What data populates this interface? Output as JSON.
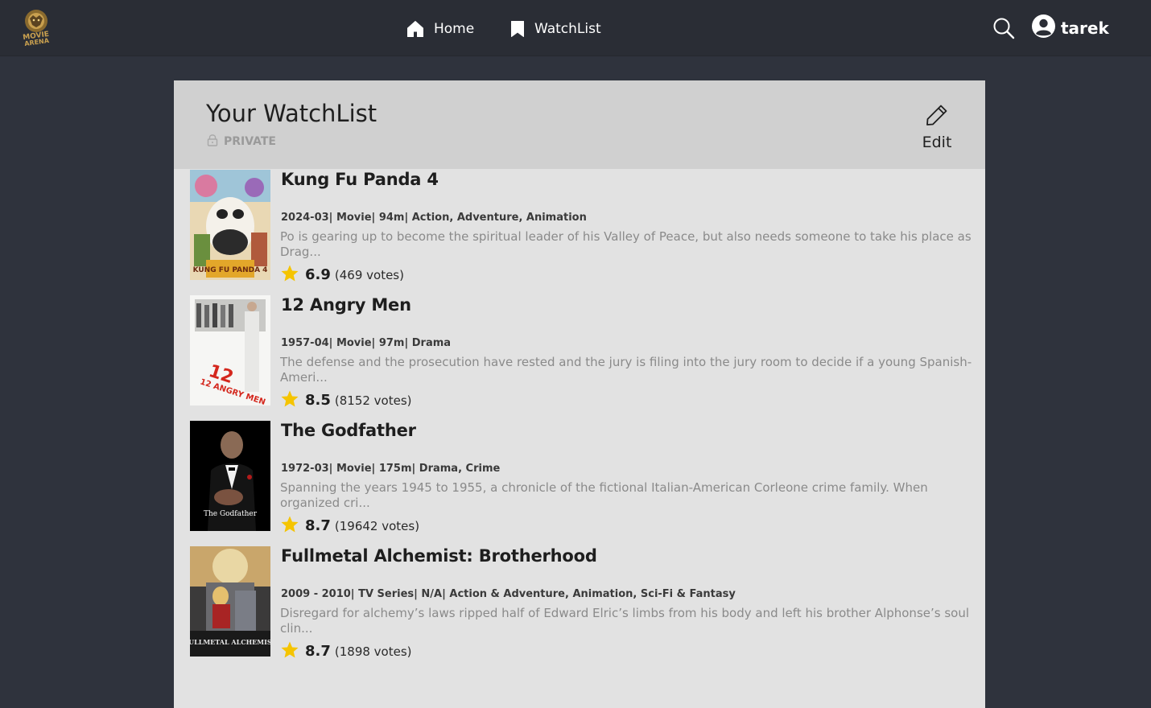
{
  "nav": {
    "logo_text": "MOVIE ARENA",
    "home_label": "Home",
    "watchlist_label": "WatchList",
    "user_name": "tarek"
  },
  "watchlist": {
    "title": "Your WatchList",
    "privacy": "PRIVATE",
    "edit_label": "Edit",
    "items": [
      {
        "title": "Kung Fu Panda 4",
        "meta": "2024-03| Movie| 94m| Action, Adventure, Animation",
        "description": "Po is gearing up to become the spiritual leader of his Valley of Peace, but also needs someone to take his place as Drag...",
        "rating": "6.9",
        "votes": "(469 votes)",
        "poster_text": "KUNG FU PANDA 4"
      },
      {
        "title": "12 Angry Men",
        "meta": "1957-04| Movie| 97m| Drama",
        "description": "The defense and the prosecution have rested and the jury is filing into the jury room to decide if a young Spanish-Ameri...",
        "rating": "8.5",
        "votes": "(8152 votes)",
        "poster_text": "12 ANGRY MEN"
      },
      {
        "title": "The Godfather",
        "meta": "1972-03| Movie| 175m| Drama, Crime",
        "description": "Spanning the years 1945 to 1955, a chronicle of the fictional Italian-American Corleone crime family. When organized cri...",
        "rating": "8.7",
        "votes": "(19642 votes)",
        "poster_text": "The Godfather"
      },
      {
        "title": "Fullmetal Alchemist: Brotherhood",
        "meta": "2009 - 2010| TV Series| N/A| Action & Adventure, Animation, Sci-Fi & Fantasy",
        "description": "Disregard for alchemy’s laws ripped half of Edward Elric’s limbs from his body and left his brother Alphonse’s soul clin...",
        "rating": "8.7",
        "votes": "(1898 votes)",
        "poster_text": "FULLMETAL ALCHEMIST"
      }
    ]
  },
  "colors": {
    "navbar": "#2a2d35",
    "page_bg": "#2f333d",
    "panel_bg": "#e2e2e2",
    "header_bg": "#d0d0d0",
    "star": "#f5c400"
  }
}
